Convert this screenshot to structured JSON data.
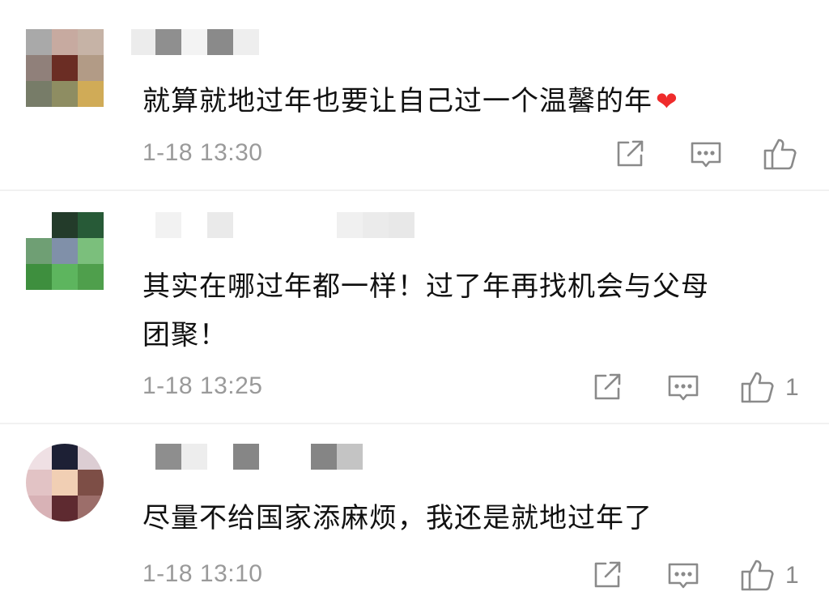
{
  "comments": [
    {
      "text": "就算就地过年也要让自己过一个温馨的年",
      "emoji": "❤",
      "time": "1-18 13:30",
      "likes": "",
      "avatar_colors": [
        "#a9a9a9",
        "#c7aaa0",
        "#c6b3a6",
        "#90807a",
        "#6b2d24",
        "#b29b86",
        "#777c68",
        "#8e8d62",
        "#d0ab57"
      ],
      "name_colors": [
        "#ececec",
        "#8f8f8f",
        "#f3f3f3",
        "#8a8a8a",
        "#eeeeee"
      ]
    },
    {
      "text_lines": [
        "其实在哪过年都一样！过了年再找机会与父母",
        "团聚！"
      ],
      "time": "1-18 13:25",
      "likes": "1",
      "avatar_colors": [
        "#ffffff",
        "#233b2a",
        "#275a37",
        "#6f9f74",
        "#8090a9",
        "#7bbf7c",
        "#3e8f3e",
        "#5db55e",
        "#4f9f4c"
      ],
      "name_colors": [
        "#f2f2f2",
        "#eaeaea",
        "#f0f0f0",
        "#ebebeb",
        "#e8e8e8"
      ]
    },
    {
      "text": "尽量不给国家添麻烦，我还是就地过年了",
      "time": "1-18 13:10",
      "likes": "1",
      "avatar_colors": [
        "#efe0e4",
        "#1d2035",
        "#dccdd3",
        "#e2c3c5",
        "#f1cfb4",
        "#7d4e46",
        "#d8b2b6",
        "#5e2a30",
        "#9c6e6a"
      ],
      "name_colors": [
        "#8e8e8e",
        "#ededed",
        "#868686",
        "#858585",
        "#c4c4c4"
      ]
    }
  ]
}
